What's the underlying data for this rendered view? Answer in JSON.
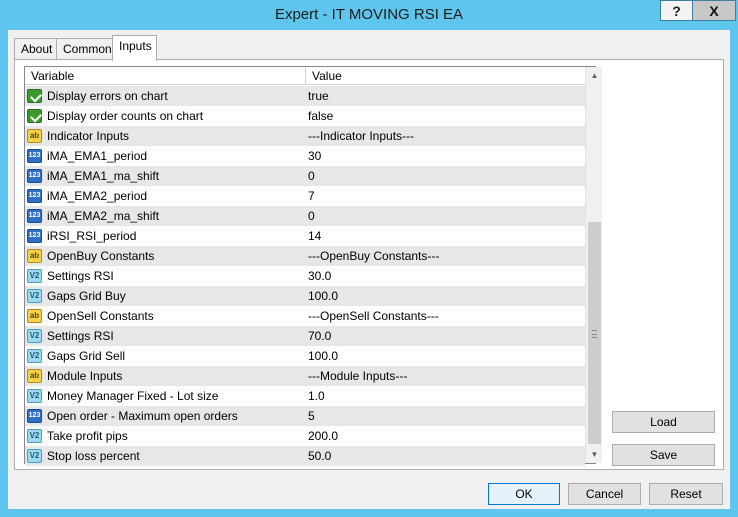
{
  "window": {
    "title": "Expert - IT MOVING RSI EA",
    "help_label": "?",
    "close_label": "X"
  },
  "tabs": [
    {
      "label": "About"
    },
    {
      "label": "Common"
    },
    {
      "label": "Inputs",
      "active": true
    }
  ],
  "grid": {
    "columns": [
      "Variable",
      "Value"
    ],
    "rows": [
      {
        "icon": "bool-icon",
        "name": "Display errors on chart",
        "value": "true"
      },
      {
        "icon": "bool-icon",
        "name": "Display order counts on chart",
        "value": "false"
      },
      {
        "icon": "string-icon",
        "name": "Indicator Inputs",
        "value": "---Indicator Inputs---"
      },
      {
        "icon": "int-icon",
        "name": "iMA_EMA1_period",
        "value": "30"
      },
      {
        "icon": "int-icon",
        "name": "iMA_EMA1_ma_shift",
        "value": "0"
      },
      {
        "icon": "int-icon",
        "name": "iMA_EMA2_period",
        "value": "7"
      },
      {
        "icon": "int-icon",
        "name": "iMA_EMA2_ma_shift",
        "value": "0"
      },
      {
        "icon": "int-icon",
        "name": "iRSI_RSI_period",
        "value": "14"
      },
      {
        "icon": "string-icon",
        "name": "OpenBuy Constants",
        "value": "---OpenBuy Constants---"
      },
      {
        "icon": "double-icon",
        "name": "Settings RSI",
        "value": "30.0"
      },
      {
        "icon": "double-icon",
        "name": "Gaps Grid Buy",
        "value": "100.0"
      },
      {
        "icon": "string-icon",
        "name": "OpenSell Constants",
        "value": "---OpenSell Constants---"
      },
      {
        "icon": "double-icon",
        "name": "Settings RSI",
        "value": "70.0"
      },
      {
        "icon": "double-icon",
        "name": "Gaps Grid Sell",
        "value": "100.0"
      },
      {
        "icon": "string-icon",
        "name": "Module Inputs",
        "value": "---Module Inputs---"
      },
      {
        "icon": "double-icon",
        "name": "Money Manager Fixed - Lot size",
        "value": "1.0"
      },
      {
        "icon": "int-icon",
        "name": "Open order - Maximum open orders",
        "value": "5"
      },
      {
        "icon": "double-icon",
        "name": "Take profit pips",
        "value": "200.0"
      },
      {
        "icon": "double-icon",
        "name": "Stop loss percent",
        "value": "50.0"
      }
    ]
  },
  "icon_labels": {
    "string": "ab",
    "int": "123",
    "double": "V2"
  },
  "buttons": {
    "load": "Load",
    "save": "Save",
    "ok": "OK",
    "cancel": "Cancel",
    "reset": "Reset"
  }
}
